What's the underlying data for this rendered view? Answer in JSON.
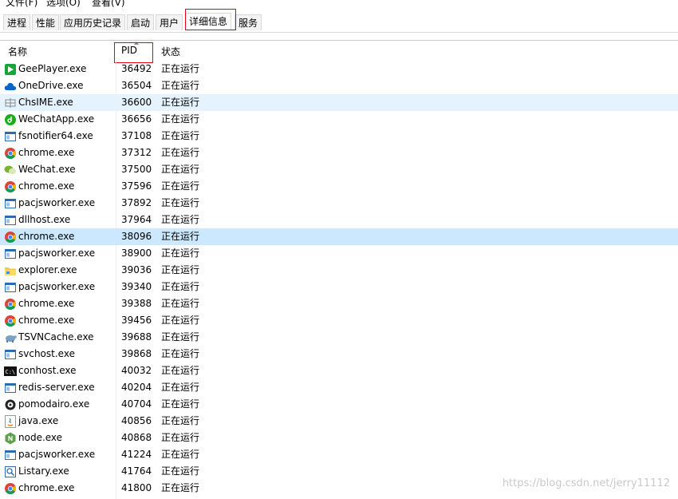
{
  "menu": [
    "文件(F)",
    "选项(O)",
    "查看(V)"
  ],
  "tabs": [
    "进程",
    "性能",
    "应用历史记录",
    "启动",
    "用户",
    "详细信息",
    "服务"
  ],
  "active_tab": "详细信息",
  "columns": {
    "name": "名称",
    "pid": "PID",
    "status": "状态"
  },
  "rows": [
    {
      "name": "GeePlayer.exe",
      "pid": "36492",
      "status": "正在运行",
      "icon": "geeplayer-icon"
    },
    {
      "name": "OneDrive.exe",
      "pid": "36504",
      "status": "正在运行",
      "icon": "onedrive-icon"
    },
    {
      "name": "ChsIME.exe",
      "pid": "36600",
      "status": "正在运行",
      "icon": "ime-icon"
    },
    {
      "name": "WeChatApp.exe",
      "pid": "36656",
      "status": "正在运行",
      "icon": "wechatapp-icon"
    },
    {
      "name": "fsnotifier64.exe",
      "pid": "37108",
      "status": "正在运行",
      "icon": "window-icon"
    },
    {
      "name": "chrome.exe",
      "pid": "37312",
      "status": "正在运行",
      "icon": "chrome-icon"
    },
    {
      "name": "WeChat.exe",
      "pid": "37500",
      "status": "正在运行",
      "icon": "wechat-icon"
    },
    {
      "name": "chrome.exe",
      "pid": "37596",
      "status": "正在运行",
      "icon": "chrome-icon"
    },
    {
      "name": "pacjsworker.exe",
      "pid": "37892",
      "status": "正在运行",
      "icon": "window-icon"
    },
    {
      "name": "dllhost.exe",
      "pid": "37964",
      "status": "正在运行",
      "icon": "window-icon"
    },
    {
      "name": "chrome.exe",
      "pid": "38096",
      "status": "正在运行",
      "icon": "chrome-icon"
    },
    {
      "name": "pacjsworker.exe",
      "pid": "38900",
      "status": "正在运行",
      "icon": "window-icon"
    },
    {
      "name": "explorer.exe",
      "pid": "39036",
      "status": "正在运行",
      "icon": "folder-icon"
    },
    {
      "name": "pacjsworker.exe",
      "pid": "39340",
      "status": "正在运行",
      "icon": "window-icon"
    },
    {
      "name": "chrome.exe",
      "pid": "39388",
      "status": "正在运行",
      "icon": "chrome-icon"
    },
    {
      "name": "chrome.exe",
      "pid": "39456",
      "status": "正在运行",
      "icon": "chrome-icon"
    },
    {
      "name": "TSVNCache.exe",
      "pid": "39688",
      "status": "正在运行",
      "icon": "tortoise-icon"
    },
    {
      "name": "svchost.exe",
      "pid": "39868",
      "status": "正在运行",
      "icon": "window-icon"
    },
    {
      "name": "conhost.exe",
      "pid": "40032",
      "status": "正在运行",
      "icon": "console-icon"
    },
    {
      "name": "redis-server.exe",
      "pid": "40204",
      "status": "正在运行",
      "icon": "window-icon"
    },
    {
      "name": "pomodairo.exe",
      "pid": "40704",
      "status": "正在运行",
      "icon": "pomodairo-icon"
    },
    {
      "name": "java.exe",
      "pid": "40856",
      "status": "正在运行",
      "icon": "java-icon"
    },
    {
      "name": "node.exe",
      "pid": "40868",
      "status": "正在运行",
      "icon": "node-icon"
    },
    {
      "name": "pacjsworker.exe",
      "pid": "41224",
      "status": "正在运行",
      "icon": "window-icon"
    },
    {
      "name": "Listary.exe",
      "pid": "41764",
      "status": "正在运行",
      "icon": "listary-icon"
    },
    {
      "name": "chrome.exe",
      "pid": "41800",
      "status": "正在运行",
      "icon": "chrome-icon"
    }
  ],
  "hovered_row": 2,
  "selected_row": 10,
  "watermark": "https://blog.csdn.net/jerry11112",
  "colors": {
    "highlight_box": "#e60012",
    "selection": "#cce8ff",
    "hover": "#e5f3ff"
  }
}
